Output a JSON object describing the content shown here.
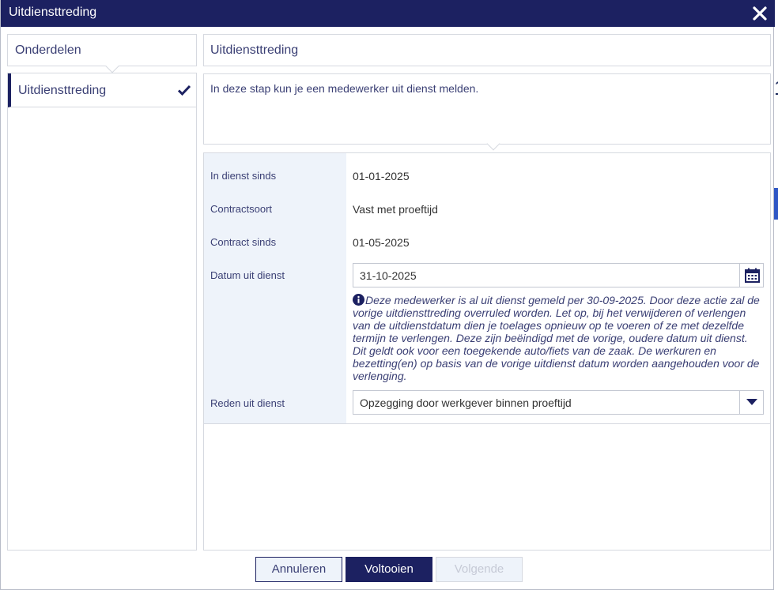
{
  "dialog": {
    "title": "Uitdiensttreding"
  },
  "left_panel": {
    "header": "Onderdelen",
    "steps": [
      {
        "label": "Uitdiensttreding",
        "completed": true
      }
    ]
  },
  "right_panel": {
    "header": "Uitdiensttreding",
    "intro": "In deze stap kun je een medewerker uit dienst melden."
  },
  "form": {
    "in_dienst_sinds": {
      "label": "In dienst sinds",
      "value": "01-01-2025"
    },
    "contractsoort": {
      "label": "Contractsoort",
      "value": "Vast met proeftijd"
    },
    "contract_sinds": {
      "label": "Contract sinds",
      "value": "01-05-2025"
    },
    "datum_uit_dienst": {
      "label": "Datum uit dienst",
      "value": "31-10-2025"
    },
    "warning_lines": [
      "Deze medewerker is al uit dienst gemeld per 30-09-2025. Door deze actie zal de",
      "vorige uitdiensttreding overruled worden. Let op, bij het verwijderen of verlengen",
      "van de uitdienstdatum dien je toelages opnieuw op te voeren of ze met dezelfde",
      "termijn te verlengen. Deze zijn beëindigd met de vorige, oudere datum uit dienst.",
      "Dit geldt ook voor een toegekende auto/fiets van de zaak. De werkuren en",
      "bezetting(en) op basis van de vorige uitdienst datum worden aangehouden voor de",
      "verlenging."
    ],
    "reden_uit_dienst": {
      "label": "Reden uit dienst",
      "value": "Opzegging door werkgever binnen proeftijd"
    }
  },
  "footer": {
    "cancel_label": "Annuleren",
    "finish_label": "Voltooien",
    "next_label": "Volgende"
  },
  "colors": {
    "primary": "#1c2161",
    "label_bg": "#eef3fa",
    "text_accent": "#3a3f74"
  }
}
